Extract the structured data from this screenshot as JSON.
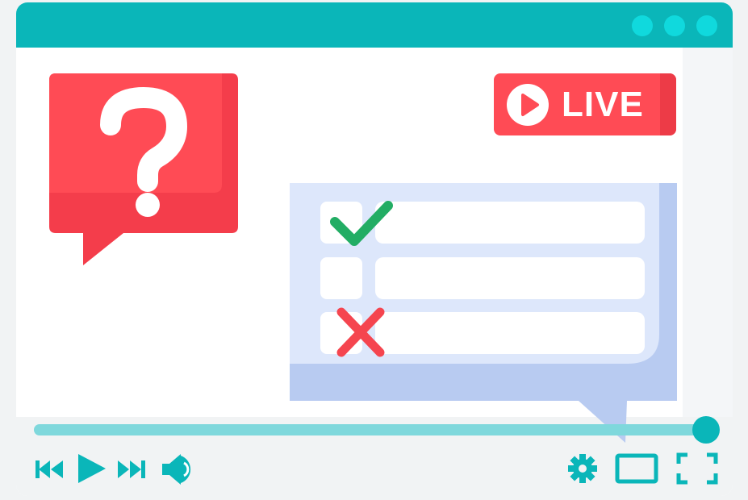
{
  "window": {
    "dots": [
      "dot-1",
      "dot-2",
      "dot-3"
    ]
  },
  "live_badge": {
    "label": "LIVE"
  },
  "question": {
    "symbol": "?"
  },
  "quiz": {
    "rows": [
      {
        "status": "correct",
        "icon": "checkmark-icon"
      },
      {
        "status": "empty",
        "icon": ""
      },
      {
        "status": "wrong",
        "icon": "cross-icon"
      }
    ]
  },
  "player": {
    "progress": 0.98,
    "controls": [
      "previous-icon",
      "play-icon",
      "next-icon",
      "volume-icon",
      "settings-icon",
      "theater-mode-icon",
      "fullscreen-icon"
    ]
  },
  "colors": {
    "accent": "#0ab6b9",
    "accent_light": "#10d9dd",
    "live_red": "#ff4b55",
    "check_green": "#22ad64",
    "cross_red": "#f5454f",
    "panel_blue": "#dde7fb"
  }
}
